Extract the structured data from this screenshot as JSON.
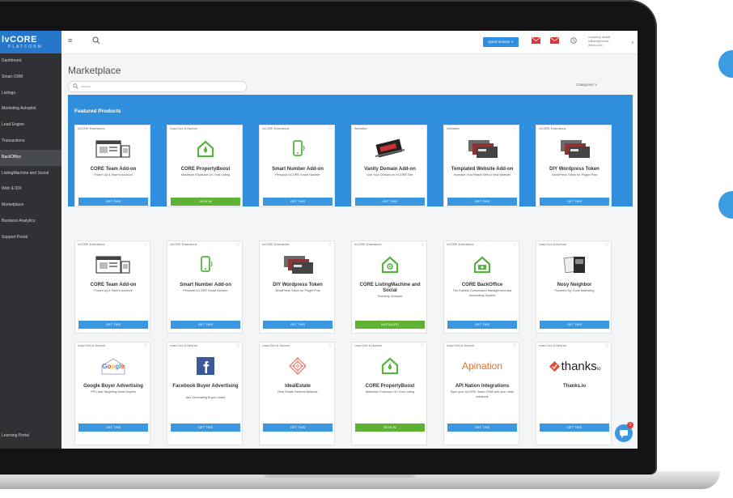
{
  "colors": {
    "primary": "#2f8fdc",
    "button_blue": "#3b98e0",
    "button_green": "#5fb233",
    "sidebar": "#2f3134",
    "house_green": "#56b340"
  },
  "brand": {
    "logo_main": "lvCORE",
    "logo_sub": "PLATFORM"
  },
  "sidebar": {
    "items": [
      {
        "label": "Dashboard",
        "active": false
      },
      {
        "label": "Smart CRM",
        "active": false
      },
      {
        "label": "Listings",
        "active": false
      },
      {
        "label": "Marketing Autopilot",
        "active": false
      },
      {
        "label": "Lead Engine",
        "active": false
      },
      {
        "label": "Transactions",
        "active": false
      },
      {
        "label": "BackOffice",
        "active": true
      },
      {
        "label": "ListingMachine and Social",
        "active": false
      },
      {
        "label": "Web & IDX",
        "active": false
      },
      {
        "label": "Marketplace",
        "active": false
      },
      {
        "label": "Business Analytics",
        "active": false
      },
      {
        "label": "Support Portal",
        "active": false
      }
    ],
    "bottom_item": "Learning Portal"
  },
  "topbar": {
    "menu_icon": "hamburger-icon",
    "search_icon": "search-icon",
    "quick_actions": "Quick actions ∨",
    "user_line1": "company details",
    "user_line2": "william@lvcore-",
    "user_line3": "demo.com",
    "caret": "∨"
  },
  "main": {
    "title": "Marketplace",
    "search_placeholder": "search",
    "categories": "Categories ∨",
    "featured_title": "Featured Products"
  },
  "cards": {
    "r1": [
      {
        "cat": "lvCORE Extensions",
        "title": "CORE Team Add-on",
        "sub": "Power Up A Team's Account",
        "btn": "GET THIS",
        "icon": "browser-devices-icon",
        "green": false
      },
      {
        "cat": "Lead Gen & Nurture",
        "title": "CORE PropertyBoost",
        "sub": "Maximum Exposure On Your Listing",
        "btn": "SIGN IN",
        "icon": "house-rocket-icon",
        "green": true
      },
      {
        "cat": "lvCORE Extensions",
        "title": "Smart Number Add-on",
        "sub": "Personal lvCORE Smart Number",
        "btn": "GET THIS",
        "icon": "phone-icon",
        "green": false
      },
      {
        "cat": "Websites",
        "title": "Vanity Domain Add-on",
        "sub": "Use Your Domain on lvCORE Site",
        "btn": "GET THIS",
        "icon": "domain-cable-icon",
        "green": false
      },
      {
        "cat": "Websites",
        "title": "Templated Website Add-on",
        "sub": "Increase Your Reach With A New Website",
        "btn": "GET THIS",
        "icon": "website-stack-icon",
        "green": false
      },
      {
        "cat": "lvCORE Extensions",
        "title": "DIY Wordpress Token",
        "sub": "WordPress Token for Plugin Pros",
        "btn": "GET THIS",
        "icon": "website-stack-icon",
        "green": false
      }
    ],
    "r2": [
      {
        "cat": "lvCORE Extensions",
        "title": "CORE Team Add-on",
        "sub": "Power Up A Team's Account",
        "btn": "GET THIS",
        "icon": "browser-devices-icon",
        "green": false
      },
      {
        "cat": "lvCORE Extensions",
        "title": "Smart Number Add-on",
        "sub": "Personal lvCORE Smart Number",
        "btn": "GET THIS",
        "icon": "phone-icon",
        "green": false
      },
      {
        "cat": "lvCORE Extensions",
        "title": "DIY Wordpress Token",
        "sub": "WordPress Token for Plugin Pros",
        "btn": "GET THIS",
        "icon": "website-stack-icon",
        "green": false
      },
      {
        "cat": "lvCORE Extensions",
        "title": "CORE ListingMachine and Social",
        "sub": "Formerly Circlepix",
        "btn": "INSTALLED",
        "icon": "house-gear-icon",
        "green": true
      },
      {
        "cat": "lvCORE Extensions",
        "title": "CORE BackOffice",
        "sub": "The Easiest Commission Management and Accounting System",
        "btn": "GET THIS",
        "icon": "house-money-icon",
        "green": false
      },
      {
        "cat": "Lead Gen & Nurture",
        "title": "Nosy Neighbor",
        "sub": "Powerful Zip Code Marketing",
        "btn": "GET THIS",
        "icon": "postcards-icon",
        "green": false
      }
    ],
    "r3": [
      {
        "cat": "Lead Gen & Nurture",
        "title": "Google Buyer Advertising",
        "sub": "PPC Ads Targeting Home Buyers",
        "btn": "GET THIS",
        "icon": "google-house-icon",
        "green": false
      },
      {
        "cat": "Lead Gen & Nurture",
        "title": "Facebook Buyer Advertising",
        "sub": "Ads Generating Buyer Leads",
        "btn": "GET THIS",
        "icon": "facebook-icon",
        "green": false
      },
      {
        "cat": "Lead Gen & Nurture",
        "title": "IdealEstate",
        "sub": "Real Estate Referral Network",
        "btn": "GET THIS",
        "icon": "idealestate-logo-icon",
        "green": false
      },
      {
        "cat": "Lead Gen & Nurture",
        "title": "CORE PropertyBoost",
        "sub": "Maximum Exposure On Your Listing",
        "btn": "SIGN IN",
        "icon": "house-rocket-icon",
        "green": true
      },
      {
        "cat": "Lead Gen & Nurture",
        "title": "API Nation Integrations",
        "sub": "Sync your lvCORE Smart CRM with your other solutions",
        "btn": "GET THIS",
        "icon": "apination-logo",
        "logo_text": "Apination",
        "green": false
      },
      {
        "cat": "Lead Gen & Nurture",
        "title": "Thanks.io",
        "sub": "",
        "btn": "GET THIS",
        "icon": "thanks-io-logo",
        "logo_text": "thanks",
        "logo_sup": "io",
        "green": false
      }
    ]
  },
  "chat_badge": "1"
}
